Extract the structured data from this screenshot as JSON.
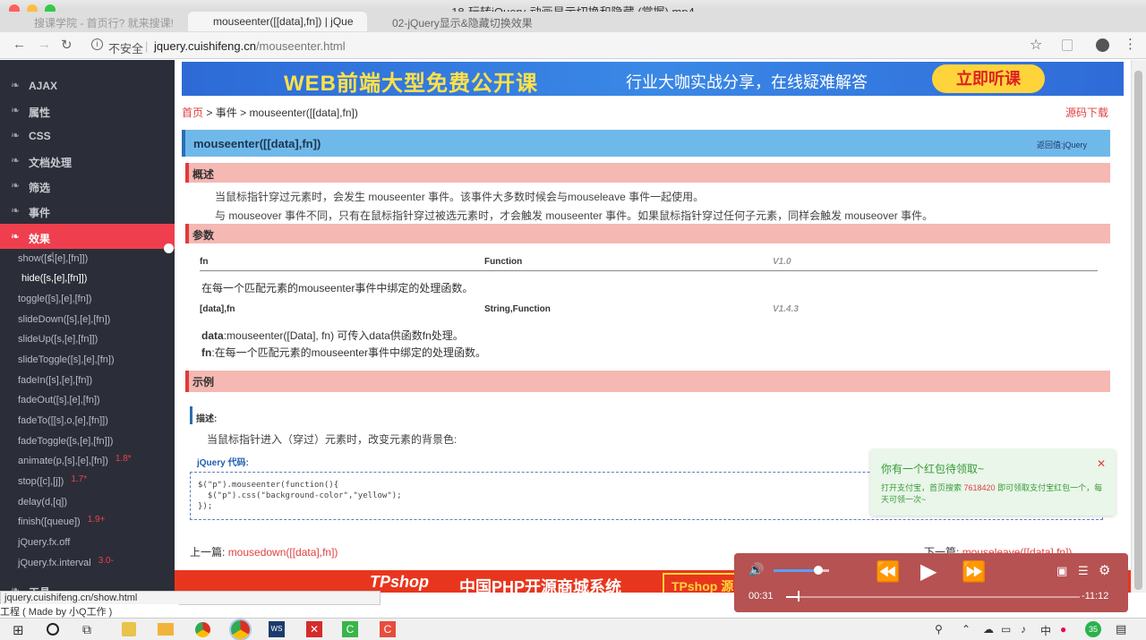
{
  "window": {
    "title": "18-玩转jQuery-动画显示切换和隐藏 (掌握).mp4"
  },
  "tabs": [
    {
      "label": "搜课学院 - 首页行? 就来搜课!"
    },
    {
      "label": "mouseenter([[data],fn]) | jQue"
    },
    {
      "label": "02-jQuery显示&隐藏切换效果"
    }
  ],
  "address": {
    "security": "不安全",
    "domain": "jquery.cuishifeng.cn",
    "path": "/mouseenter.html"
  },
  "sidebar": {
    "categories": [
      {
        "label": "AJAX"
      },
      {
        "label": "属性"
      },
      {
        "label": "CSS"
      },
      {
        "label": "文档处理"
      },
      {
        "label": "筛选"
      },
      {
        "label": "事件"
      },
      {
        "label": "效果"
      }
    ],
    "items": [
      {
        "label": "show([s,[e],[fn]])",
        "ver": ""
      },
      {
        "label": "hide([s,[e],[fn]])",
        "ver": ""
      },
      {
        "label": "toggle([s],[e],[fn])",
        "ver": ""
      },
      {
        "label": "slideDown([s],[e],[fn])",
        "ver": ""
      },
      {
        "label": "slideUp([s,[e],[fn]])",
        "ver": ""
      },
      {
        "label": "slideToggle([s],[e],[fn])",
        "ver": ""
      },
      {
        "label": "fadeIn([s],[e],[fn])",
        "ver": ""
      },
      {
        "label": "fadeOut([s],[e],[fn])",
        "ver": ""
      },
      {
        "label": "fadeTo([[s],o,[e],[fn]])",
        "ver": ""
      },
      {
        "label": "fadeToggle([s,[e],[fn]])",
        "ver": ""
      },
      {
        "label": "animate(p,[s],[e],[fn])",
        "ver": "1.8*"
      },
      {
        "label": "stop([c],[j])",
        "ver": "1.7*"
      },
      {
        "label": "delay(d,[q])",
        "ver": ""
      },
      {
        "label": "finish([queue])",
        "ver": "1.9+"
      },
      {
        "label": "jQuery.fx.off",
        "ver": ""
      },
      {
        "label": "jQuery.fx.interval",
        "ver": "3.0-"
      }
    ],
    "next_cat": "工具"
  },
  "banner": {
    "title": "WEB前端大型免费公开课",
    "subtitle": "行业大咖实战分享，在线疑难解答",
    "cta": "立即听课"
  },
  "breadcrumb": {
    "home": "首页",
    "sep1": ">",
    "section": "事件",
    "sep2": ">",
    "current": "mouseenter([[data],fn])",
    "download": "源码下载"
  },
  "api": {
    "name": "mouseenter([[data],fn])",
    "returns": "返回值:jQuery"
  },
  "overview": {
    "heading": "概述",
    "line1": "当鼠标指针穿过元素时，会发生 mouseenter 事件。该事件大多数时候会与mouseleave 事件一起使用。",
    "line2": "与 mouseover 事件不同，只有在鼠标指针穿过被选元素时，才会触发 mouseenter 事件。如果鼠标指针穿过任何子元素，同样会触发 mouseover 事件。"
  },
  "params": {
    "heading": "参数",
    "p1": {
      "name": "fn",
      "type": "Function",
      "ver": "V1.0",
      "desc": "在每一个匹配元素的mouseenter事件中绑定的处理函数。"
    },
    "p2": {
      "name": "[data],fn",
      "type": "String,Function",
      "ver": "V1.4.3",
      "desc1_b": "data",
      "desc1": ":mouseenter([Data], fn) 可传入data供函数fn处理。",
      "desc2_b": "fn",
      "desc2": ":在每一个匹配元素的mouseenter事件中绑定的处理函数。"
    }
  },
  "example": {
    "heading": "示例",
    "desc_label": "描述:",
    "desc": "当鼠标指针进入（穿过）元素时，改变元素的背景色:",
    "code_label": "jQuery 代码:",
    "code1": "$(\"p\").mouseenter(function(){",
    "code2": "  $(\"p\").css(\"background-color\",\"yellow\");",
    "code3": "});"
  },
  "pager": {
    "prev_label": "上一篇:",
    "prev": "mousedown([[data],fn])",
    "next_label": "下一篇:",
    "next": "mouseleave([[data],fn])"
  },
  "footer_banner": {
    "brand": "TPshop",
    "title": "中国PHP开源商城系统",
    "tag": "TPshop 源"
  },
  "status_url": "jquery.cuishifeng.cn/show.html",
  "status_bottom": "工程 ( Made by 小Q工作 )",
  "toast": {
    "title": "你有一个红包待领取~",
    "line_pre": "打开支付宝，首页搜索 ",
    "code": "7618420",
    "line_post": " 即可领取支付宝红包一个，每天可领一次~"
  },
  "player": {
    "elapsed": "00:31",
    "remaining": "-11:12",
    "progress": 0.04,
    "volume": 0.8
  },
  "taskbar": {
    "clock_a": "中",
    "badge": "35"
  }
}
